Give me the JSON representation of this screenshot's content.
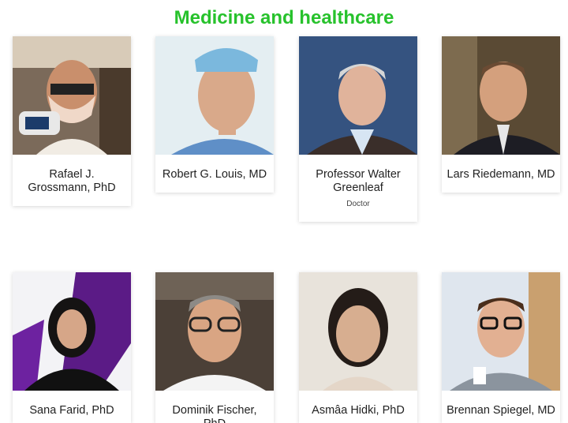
{
  "section": {
    "title": "Medicine and healthcare"
  },
  "people": [
    {
      "name": "Rafael J. Grossmann, PhD",
      "role": ""
    },
    {
      "name": "Robert G. Louis, MD",
      "role": ""
    },
    {
      "name": "Professor Walter Greenleaf",
      "role": "Doctor"
    },
    {
      "name": "Lars Riedemann, MD",
      "role": ""
    },
    {
      "name": "Sana Farid, PhD",
      "role": ""
    },
    {
      "name": "Dominik Fischer, PhD",
      "role": ""
    },
    {
      "name": "Asmâa Hidki, PhD",
      "role": ""
    },
    {
      "name": "Brennan Spiegel, MD",
      "role": ""
    }
  ],
  "colors": {
    "accent": "#27c22c"
  }
}
